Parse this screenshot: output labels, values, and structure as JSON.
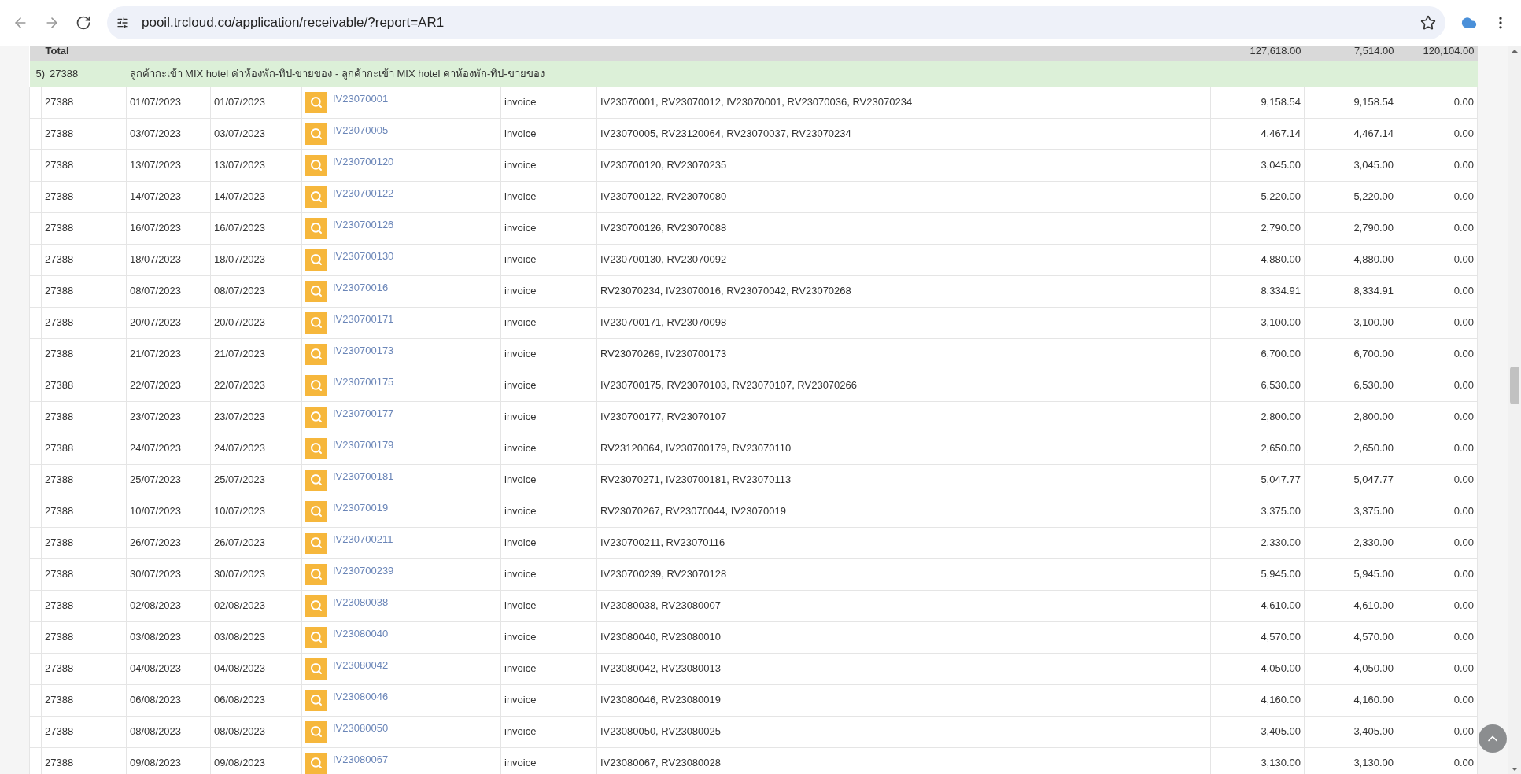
{
  "browser": {
    "url": "pooil.trcloud.co/application/receivable/?report=AR1"
  },
  "total_row": {
    "label": "Total",
    "values": [
      "127,618.00",
      "7,514.00",
      "120,104.00"
    ]
  },
  "group": {
    "index": "5)",
    "code": "27388",
    "name": "ลูกค้ากะเข้า MIX hotel ค่าห้องพัก-ทิป-ขายของ - ลูกค้ากะเข้า MIX hotel ค่าห้องพัก-ทิป-ขายของ"
  },
  "rows": [
    [
      "27388",
      "01/07/2023",
      "01/07/2023",
      "IV23070001",
      "invoice",
      "IV23070001, RV23070012, IV23070001, RV23070036, RV23070234",
      "9,158.54",
      "9,158.54",
      "0.00"
    ],
    [
      "27388",
      "03/07/2023",
      "03/07/2023",
      "IV23070005",
      "invoice",
      "IV23070005, RV23120064, RV23070037, RV23070234",
      "4,467.14",
      "4,467.14",
      "0.00"
    ],
    [
      "27388",
      "13/07/2023",
      "13/07/2023",
      "IV230700120",
      "invoice",
      "IV230700120, RV23070235",
      "3,045.00",
      "3,045.00",
      "0.00"
    ],
    [
      "27388",
      "14/07/2023",
      "14/07/2023",
      "IV230700122",
      "invoice",
      "IV230700122, RV23070080",
      "5,220.00",
      "5,220.00",
      "0.00"
    ],
    [
      "27388",
      "16/07/2023",
      "16/07/2023",
      "IV230700126",
      "invoice",
      "IV230700126, RV23070088",
      "2,790.00",
      "2,790.00",
      "0.00"
    ],
    [
      "27388",
      "18/07/2023",
      "18/07/2023",
      "IV230700130",
      "invoice",
      "IV230700130, RV23070092",
      "4,880.00",
      "4,880.00",
      "0.00"
    ],
    [
      "27388",
      "08/07/2023",
      "08/07/2023",
      "IV23070016",
      "invoice",
      "RV23070234, IV23070016, RV23070042, RV23070268",
      "8,334.91",
      "8,334.91",
      "0.00"
    ],
    [
      "27388",
      "20/07/2023",
      "20/07/2023",
      "IV230700171",
      "invoice",
      "IV230700171, RV23070098",
      "3,100.00",
      "3,100.00",
      "0.00"
    ],
    [
      "27388",
      "21/07/2023",
      "21/07/2023",
      "IV230700173",
      "invoice",
      "RV23070269, IV230700173",
      "6,700.00",
      "6,700.00",
      "0.00"
    ],
    [
      "27388",
      "22/07/2023",
      "22/07/2023",
      "IV230700175",
      "invoice",
      "IV230700175, RV23070103, RV23070107, RV23070266",
      "6,530.00",
      "6,530.00",
      "0.00"
    ],
    [
      "27388",
      "23/07/2023",
      "23/07/2023",
      "IV230700177",
      "invoice",
      "IV230700177, RV23070107",
      "2,800.00",
      "2,800.00",
      "0.00"
    ],
    [
      "27388",
      "24/07/2023",
      "24/07/2023",
      "IV230700179",
      "invoice",
      "RV23120064, IV230700179, RV23070110",
      "2,650.00",
      "2,650.00",
      "0.00"
    ],
    [
      "27388",
      "25/07/2023",
      "25/07/2023",
      "IV230700181",
      "invoice",
      "RV23070271, IV230700181, RV23070113",
      "5,047.77",
      "5,047.77",
      "0.00"
    ],
    [
      "27388",
      "10/07/2023",
      "10/07/2023",
      "IV23070019",
      "invoice",
      "RV23070267, RV23070044, IV23070019",
      "3,375.00",
      "3,375.00",
      "0.00"
    ],
    [
      "27388",
      "26/07/2023",
      "26/07/2023",
      "IV230700211",
      "invoice",
      "IV230700211, RV23070116",
      "2,330.00",
      "2,330.00",
      "0.00"
    ],
    [
      "27388",
      "30/07/2023",
      "30/07/2023",
      "IV230700239",
      "invoice",
      "IV230700239, RV23070128",
      "5,945.00",
      "5,945.00",
      "0.00"
    ],
    [
      "27388",
      "02/08/2023",
      "02/08/2023",
      "IV23080038",
      "invoice",
      "IV23080038, RV23080007",
      "4,610.00",
      "4,610.00",
      "0.00"
    ],
    [
      "27388",
      "03/08/2023",
      "03/08/2023",
      "IV23080040",
      "invoice",
      "IV23080040, RV23080010",
      "4,570.00",
      "4,570.00",
      "0.00"
    ],
    [
      "27388",
      "04/08/2023",
      "04/08/2023",
      "IV23080042",
      "invoice",
      "IV23080042, RV23080013",
      "4,050.00",
      "4,050.00",
      "0.00"
    ],
    [
      "27388",
      "06/08/2023",
      "06/08/2023",
      "IV23080046",
      "invoice",
      "IV23080046, RV23080019",
      "4,160.00",
      "4,160.00",
      "0.00"
    ],
    [
      "27388",
      "08/08/2023",
      "08/08/2023",
      "IV23080050",
      "invoice",
      "IV23080050, RV23080025",
      "3,405.00",
      "3,405.00",
      "0.00"
    ],
    [
      "27388",
      "09/08/2023",
      "09/08/2023",
      "IV23080067",
      "invoice",
      "IV23080067, RV23080028",
      "3,130.00",
      "3,130.00",
      "0.00"
    ]
  ]
}
